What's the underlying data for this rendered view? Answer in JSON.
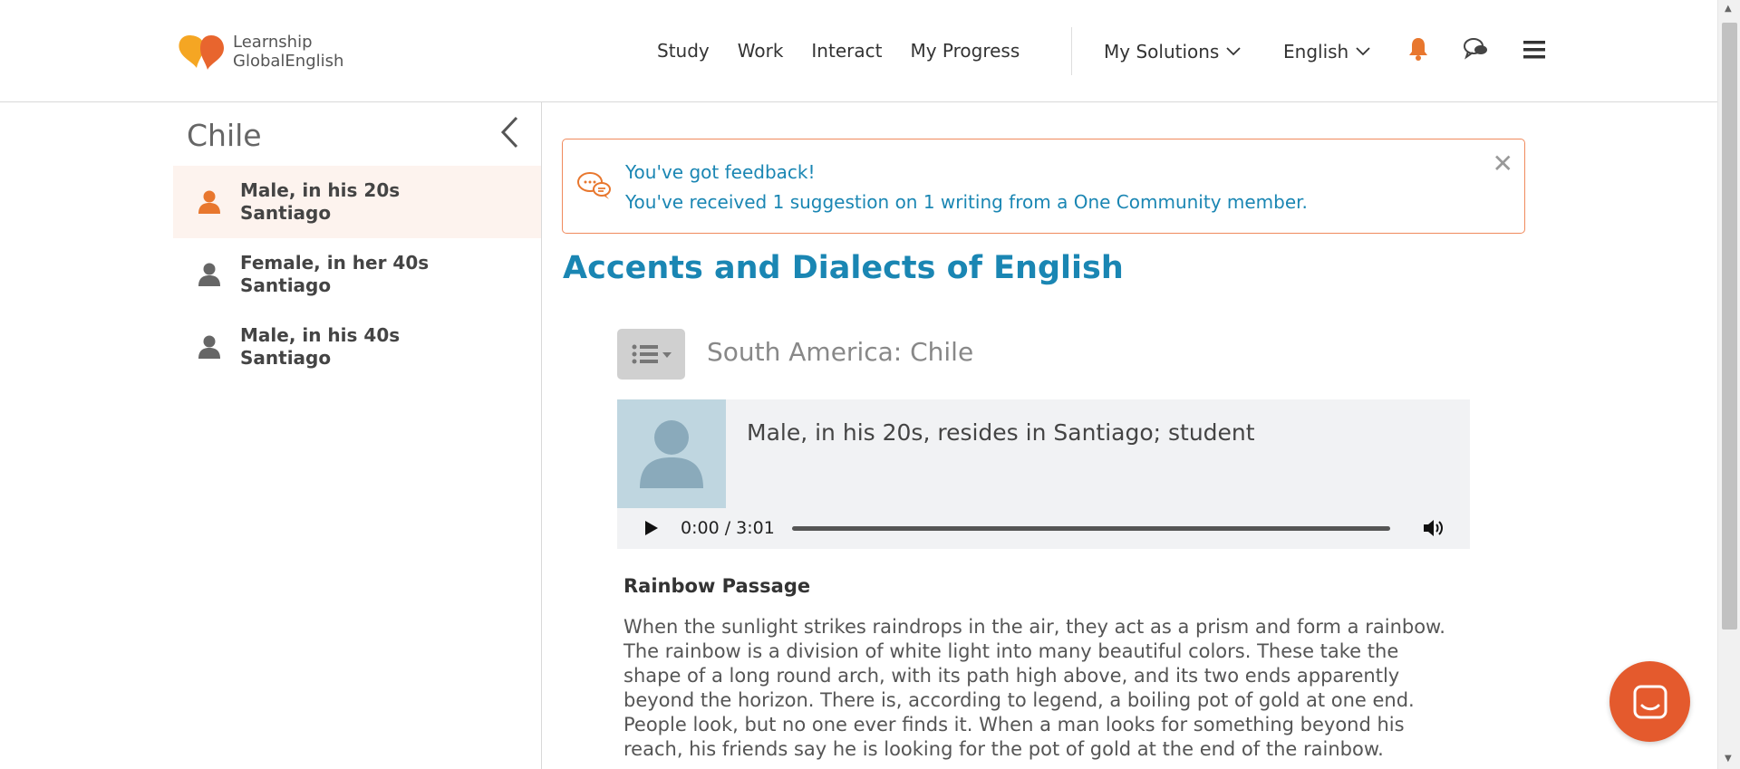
{
  "header": {
    "logo_line1": "Learnship",
    "logo_line2": "GlobalEnglish",
    "nav": [
      "Study",
      "Work",
      "Interact",
      "My Progress"
    ],
    "solutions_label": "My Solutions",
    "language_label": "English"
  },
  "sidebar": {
    "title": "Chile",
    "items": [
      {
        "line1": "Male, in his 20s",
        "line2": "Santiago",
        "active": true
      },
      {
        "line1": "Female, in her 40s",
        "line2": "Santiago",
        "active": false
      },
      {
        "line1": "Male, in his 40s",
        "line2": "Santiago",
        "active": false
      }
    ]
  },
  "feedback": {
    "line1": "You've got feedback!",
    "line2": "You've received 1 suggestion on 1 writing from a One Community member."
  },
  "main": {
    "page_title": "Accents and Dialects of English",
    "section_title": "South America: Chile",
    "audio_desc": "Male, in his 20s, resides in Santiago; student",
    "time": "0:00 / 3:01",
    "passage_title": "Rainbow Passage",
    "passage_text": "When the sunlight strikes raindrops in the air, they act as a prism and form a rainbow. The rainbow is a division of white light into many beautiful colors. These take the shape of a long round arch, with its path high above, and its two ends apparently beyond the horizon. There is, according to legend, a boiling pot of gold at one end. People look, but no one ever finds it. When a man looks for something beyond his reach, his friends say he is looking for the pot of gold at the end of the rainbow."
  },
  "colors": {
    "accent": "#1a86b3",
    "brand_orange": "#e45a2d",
    "active_icon": "#e8772e"
  },
  "icons": {
    "logo": "learnship-logo",
    "bell": "bell-icon",
    "chat": "chat-bubbles-icon",
    "menu": "hamburger-icon",
    "collapse": "chevron-left-icon",
    "person": "person-icon",
    "list": "list-menu-icon",
    "play": "play-icon",
    "volume": "volume-icon",
    "messenger": "messenger-icon",
    "close": "close-icon"
  }
}
